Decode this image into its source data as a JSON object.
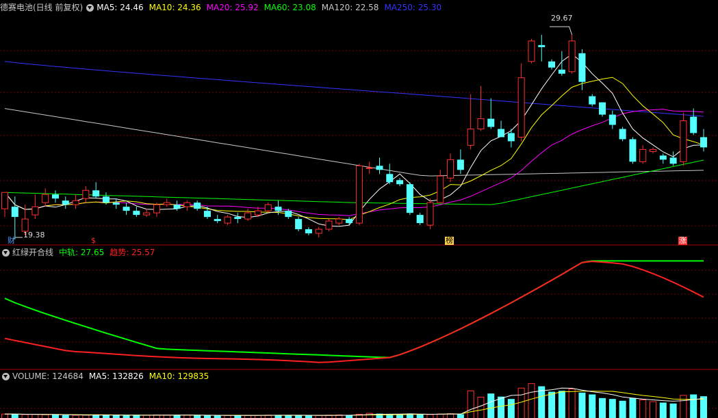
{
  "header": {
    "title": "德赛电池(日线 前复权)",
    "ma": [
      {
        "label": "MA5: 24.46",
        "color": "#ffffff"
      },
      {
        "label": "MA10: 24.36",
        "color": "#ffff00"
      },
      {
        "label": "MA20: 25.92",
        "color": "#ff00ff"
      },
      {
        "label": "MA60: 23.08",
        "color": "#00ff00"
      },
      {
        "label": "MA120: 22.58",
        "color": "#c8c8c8"
      },
      {
        "label": "MA250: 25.30",
        "color": "#3333ff"
      }
    ]
  },
  "price_pane": {
    "high_label": "29.67",
    "low_label": "19.38",
    "markers": [
      {
        "text": "财",
        "color": "#5aa0ff"
      },
      {
        "text": "$",
        "color": "#ff3030"
      },
      {
        "text": "榜",
        "color": "#ffd24a"
      },
      {
        "text": "涨",
        "color": "#ff3030"
      }
    ]
  },
  "indicator": {
    "name": "红绿开合线",
    "zhonggui_label": "中轨: 27.65",
    "qushi_label": "趋势: 25.57",
    "colors": {
      "zhonggui": "#00ff00",
      "qushi": "#ff2020"
    }
  },
  "volume": {
    "label": "VOLUME: 124684",
    "ma5_label": "MA5: 132826",
    "ma10_label": "MA10: 129835"
  },
  "colors": {
    "up": "#ff3030",
    "down": "#54ffff",
    "grid": "#7a0000"
  },
  "chart_data": {
    "type": "candlestick",
    "ohlc": [
      [
        20.7,
        21.5,
        21.2,
        20.3
      ],
      [
        20.8,
        20.3,
        19.2,
        21.3
      ],
      [
        19.6,
        20.2,
        20.9,
        19.4
      ],
      [
        20.4,
        20.8,
        21.4,
        20.2
      ],
      [
        21.0,
        21.4,
        21.7,
        20.8
      ],
      [
        21.4,
        21.2,
        21.6,
        21.0
      ],
      [
        21.1,
        20.9,
        21.3,
        20.7
      ],
      [
        20.9,
        21.1,
        21.4,
        20.7
      ],
      [
        21.2,
        21.6,
        21.8,
        21.0
      ],
      [
        21.6,
        21.3,
        22.0,
        21.2
      ],
      [
        21.3,
        21.0,
        21.5,
        20.9
      ],
      [
        21.0,
        20.9,
        21.2,
        20.7
      ],
      [
        20.8,
        20.6,
        21.0,
        20.4
      ],
      [
        20.6,
        20.4,
        20.8,
        20.3
      ],
      [
        20.4,
        20.5,
        20.7,
        20.3
      ],
      [
        20.5,
        20.9,
        21.0,
        20.3
      ],
      [
        20.9,
        21.0,
        21.2,
        20.8
      ],
      [
        20.9,
        20.7,
        21.1,
        20.6
      ],
      [
        20.8,
        21.0,
        21.1,
        20.6
      ],
      [
        21.0,
        20.7,
        21.1,
        20.6
      ],
      [
        20.6,
        20.3,
        20.8,
        20.2
      ],
      [
        20.2,
        20.1,
        20.4,
        20.0
      ],
      [
        20.0,
        20.3,
        20.4,
        19.9
      ],
      [
        20.3,
        20.2,
        20.5,
        20.0
      ],
      [
        20.2,
        20.5,
        20.7,
        20.1
      ],
      [
        20.4,
        20.6,
        20.8,
        20.3
      ],
      [
        20.6,
        20.9,
        21.0,
        20.5
      ],
      [
        20.8,
        20.6,
        21.1,
        20.4
      ],
      [
        20.6,
        20.3,
        20.7,
        20.2
      ],
      [
        20.2,
        19.7,
        20.3,
        19.6
      ],
      [
        19.7,
        19.5,
        19.8,
        19.4
      ],
      [
        19.5,
        19.7,
        19.8,
        19.3
      ],
      [
        19.7,
        20.1,
        20.2,
        19.6
      ],
      [
        20.0,
        20.2,
        20.3,
        19.9
      ],
      [
        20.2,
        20.0,
        20.3,
        19.9
      ],
      [
        20.0,
        22.8,
        22.9,
        19.9
      ],
      [
        22.7,
        22.7,
        23.0,
        22.4
      ],
      [
        22.8,
        22.6,
        23.2,
        22.4
      ],
      [
        22.4,
        22.0,
        22.9,
        21.9
      ],
      [
        22.1,
        21.9,
        22.2,
        21.8
      ],
      [
        21.9,
        20.5,
        22.0,
        20.4
      ],
      [
        20.4,
        20.0,
        20.5,
        19.9
      ],
      [
        19.9,
        21.0,
        21.2,
        19.7
      ],
      [
        21.0,
        22.3,
        22.6,
        21.0
      ],
      [
        22.2,
        23.1,
        23.4,
        22.0
      ],
      [
        23.1,
        22.6,
        23.6,
        22.4
      ],
      [
        23.8,
        24.6,
        26.3,
        23.6
      ],
      [
        24.6,
        25.1,
        26.7,
        24.5
      ],
      [
        25.1,
        24.7,
        26.1,
        24.6
      ],
      [
        24.6,
        24.2,
        25.0,
        24.2
      ],
      [
        24.4,
        24.0,
        24.6,
        23.7
      ],
      [
        24.2,
        27.1,
        27.8,
        24.0
      ],
      [
        27.9,
        28.9,
        29.0,
        27.8
      ],
      [
        28.7,
        28.6,
        29.2,
        27.9
      ],
      [
        27.9,
        27.6,
        28.0,
        27.5
      ],
      [
        27.5,
        27.3,
        28.4,
        27.2
      ],
      [
        27.4,
        28.9,
        29.2,
        27.3
      ],
      [
        28.3,
        26.9,
        28.5,
        26.5
      ],
      [
        26.2,
        25.8,
        26.3,
        25.7
      ],
      [
        25.9,
        25.3,
        25.9,
        25.2
      ],
      [
        25.3,
        24.8,
        25.5,
        24.6
      ],
      [
        24.6,
        24.1,
        24.7,
        24.0
      ],
      [
        24.1,
        23.0,
        24.2,
        22.9
      ],
      [
        23.0,
        23.6,
        23.8,
        22.9
      ],
      [
        23.5,
        23.6,
        23.7,
        23.4
      ],
      [
        23.3,
        23.1,
        23.4,
        22.9
      ],
      [
        23.2,
        22.9,
        23.5,
        22.8
      ],
      [
        23.0,
        25.0,
        25.4,
        22.8
      ],
      [
        25.2,
        24.4,
        25.6,
        24.3
      ],
      [
        24.2,
        23.7,
        24.6,
        23.5
      ]
    ],
    "volume": [
      22000,
      21000,
      19000,
      20000,
      18000,
      17000,
      16000,
      15000,
      16000,
      17000,
      16000,
      15000,
      14000,
      15000,
      16000,
      17000,
      16000,
      15000,
      16000,
      15000,
      14000,
      13000,
      14000,
      15000,
      14000,
      15000,
      16000,
      17000,
      15000,
      14000,
      13000,
      14000,
      16000,
      17000,
      15000,
      21000,
      26000,
      24000,
      20000,
      18000,
      25000,
      22000,
      19000,
      22000,
      24000,
      21000,
      150000,
      115000,
      135000,
      118000,
      105000,
      165000,
      190000,
      175000,
      145000,
      150000,
      160000,
      140000,
      130000,
      110000,
      105000,
      95000,
      110000,
      100000,
      90000,
      85000,
      80000,
      125000,
      130000,
      120000
    ],
    "indicator_zhonggui_first": 23.5,
    "indicator_qushi_last": 25.57,
    "ylim_price": [
      19.0,
      30.3
    ]
  }
}
